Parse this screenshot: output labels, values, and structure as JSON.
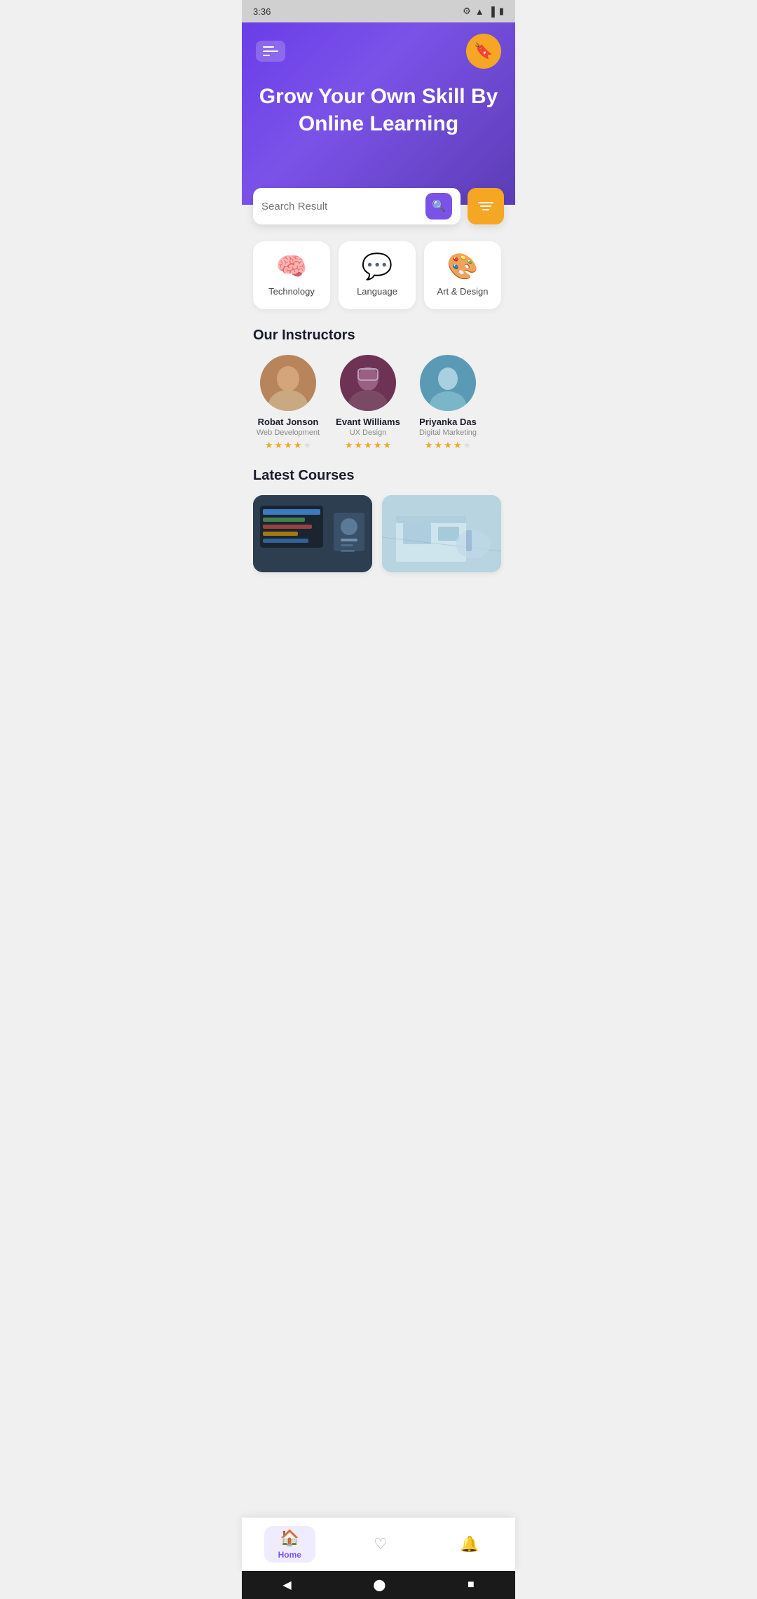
{
  "status": {
    "time": "3:36",
    "wifi": "📶",
    "signal": "📶",
    "battery": "🔋"
  },
  "hero": {
    "title": "Grow Your Own Skill By Online Learning",
    "search_placeholder": "Search Result"
  },
  "categories": [
    {
      "id": "technology",
      "label": "Technology",
      "icon": "🧠"
    },
    {
      "id": "language",
      "label": "Language",
      "icon": "💬"
    },
    {
      "id": "art-design",
      "label": "Art & Design",
      "icon": "🎨"
    }
  ],
  "instructors_section": {
    "title": "Our Instructors",
    "instructors": [
      {
        "name": "Robat Jonson",
        "skill": "Web Development",
        "rating": 4,
        "avatar_class": "av1",
        "avatar_emoji": "👨"
      },
      {
        "name": "Evant Williams",
        "skill": "UX Design",
        "rating": 4.5,
        "avatar_class": "av2",
        "avatar_emoji": "👨"
      },
      {
        "name": "Priyanka Das",
        "skill": "Digital Marketing",
        "rating": 4,
        "avatar_class": "av3",
        "avatar_emoji": "👩"
      }
    ]
  },
  "courses_section": {
    "title": "Latest Courses",
    "courses": [
      {
        "id": "course1",
        "thumb_class": "ct1",
        "thumb_emoji": "💻"
      },
      {
        "id": "course2",
        "thumb_class": "ct2",
        "thumb_emoji": "📐"
      }
    ]
  },
  "bottom_nav": {
    "items": [
      {
        "id": "home",
        "label": "Home",
        "icon": "🏠",
        "active": true
      },
      {
        "id": "favorites",
        "label": "",
        "icon": "♡",
        "active": false
      },
      {
        "id": "notifications",
        "label": "",
        "icon": "🔔",
        "active": false
      }
    ]
  },
  "android_nav": {
    "back": "◀",
    "home": "⬤",
    "recent": "■"
  }
}
